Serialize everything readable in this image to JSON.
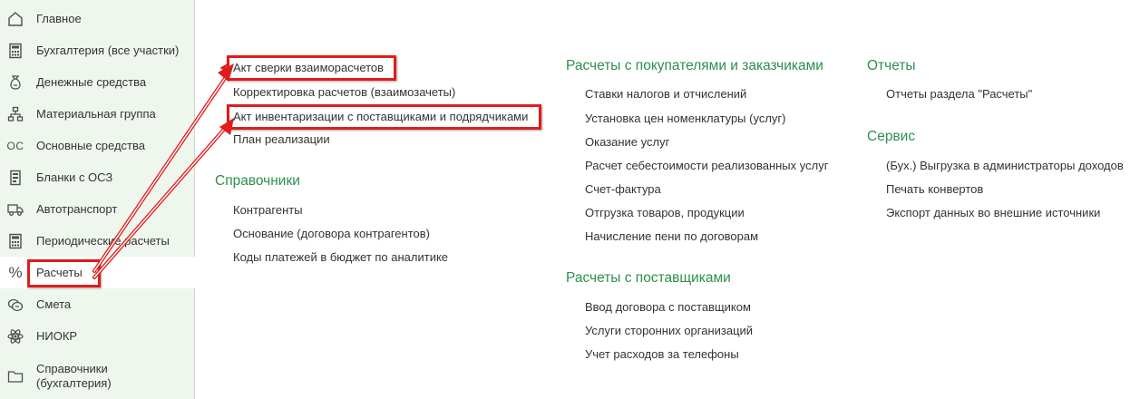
{
  "sidebar": {
    "items": [
      {
        "label": "Главное",
        "icon": "home-icon"
      },
      {
        "label": "Бухгалтерия (все участки)",
        "icon": "calculator-icon"
      },
      {
        "label": "Денежные средства",
        "icon": "money-bag-icon"
      },
      {
        "label": "Материальная группа",
        "icon": "hierarchy-icon"
      },
      {
        "label": "Основные средства",
        "icon": "oc-icon",
        "icon_text": "ОС"
      },
      {
        "label": "Бланки с ОСЗ",
        "icon": "document-icon"
      },
      {
        "label": "Автотранспорт",
        "icon": "truck-icon"
      },
      {
        "label": "Периодические расчеты",
        "icon": "calculator-icon"
      },
      {
        "label": "Расчеты",
        "icon": "percent-icon",
        "icon_text": "%",
        "active": true
      },
      {
        "label": "Смета",
        "icon": "coins-icon"
      },
      {
        "label": "НИОКР",
        "icon": "atom-icon"
      },
      {
        "label": "Справочники (бухгалтерия)",
        "icon": "folder-icon",
        "label_line1": "Справочники",
        "label_line2": "(бухгалтерия)"
      }
    ]
  },
  "main": {
    "col1": {
      "links": [
        "Акт сверки взаиморасчетов",
        "Корректировка расчетов (взаимозачеты)",
        "Акт инвентаризации с поставщиками и подрядчиками",
        "План реализации"
      ],
      "sections": [
        {
          "title": "Справочники",
          "links": [
            "Контрагенты",
            "Основание (договора контрагентов)",
            "Коды платежей в бюджет по аналитике"
          ]
        }
      ]
    },
    "col2": {
      "sections": [
        {
          "title": "Расчеты с покупателями и заказчиками",
          "links": [
            "Ставки налогов и отчислений",
            "Установка цен номенклатуры (услуг)",
            "Оказание услуг",
            "Расчет себестоимости реализованных услуг",
            "Счет-фактура",
            "Отгрузка товаров, продукции",
            "Начисление пени по договорам"
          ]
        },
        {
          "title": "Расчеты с поставщиками",
          "links": [
            "Ввод договора с поставщиком",
            "Услуги сторонних организаций",
            "Учет расходов за телефоны"
          ]
        }
      ]
    },
    "col3": {
      "sections": [
        {
          "title": "Отчеты",
          "links": [
            "Отчеты раздела \"Расчеты\""
          ]
        },
        {
          "title": "Сервис",
          "links": [
            "(Бух.) Выгрузка в администраторы доходов",
            "Печать конвертов",
            "Экспорт данных во внешние источники"
          ]
        }
      ]
    }
  },
  "colors": {
    "sidebar_bg": "#eef6ee",
    "section_title": "#2d8f4e",
    "annotation_red": "#e21b1b",
    "text": "#333333"
  }
}
